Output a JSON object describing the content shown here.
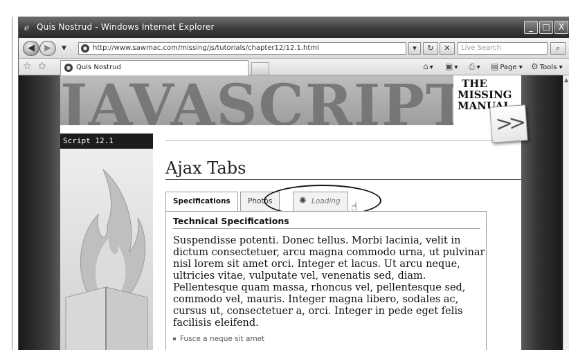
{
  "window": {
    "title": "Quis Nostrud - Windows Internet Explorer",
    "controls": {
      "minimize": "_",
      "maximize": "□",
      "close": "X"
    }
  },
  "address_bar": {
    "url": "http://www.sawmac.com/missing/js/tutorials/chapter12/12.1.html",
    "search_placeholder": "Live Search"
  },
  "tab_bar": {
    "active_tab": "Quis Nostrud",
    "commands": {
      "page": "Page",
      "tools": "Tools"
    }
  },
  "banner": {
    "word": "JAVASCRIPT",
    "lines": [
      "THE",
      "MISSING",
      "MANUAL"
    ],
    "arrow_label": ">>"
  },
  "sidebar": {
    "label": "Script 12.1"
  },
  "main": {
    "title": "Ajax Tabs",
    "tabs": [
      {
        "label": "Specifications",
        "active": true
      },
      {
        "label": "Photos",
        "active": false
      },
      {
        "label": "Loading",
        "active": false,
        "loading": true
      }
    ],
    "panel": {
      "heading": "Technical Specifications",
      "paragraph": "Suspendisse potenti. Donec tellus. Morbi lacinia, velit in dictum consectetuer, arcu magna commodo urna, ut pulvinar nisl lorem sit amet orci. Integer et lacus. Ut arcu neque, ultricies vitae, vulputate vel, venenatis sed, diam. Pellentesque quam massa, rhoncus vel, pellentesque sed, commodo vel, mauris. Integer magna libero, sodales ac, cursus ut, consectetuer a, orci. Integer in pede eget felis facilisis eleifend.",
      "list_item": "Fusce a neque sit amet"
    }
  },
  "icons": {
    "ie_logo": "ie-logo-icon",
    "back": "back-arrow-icon",
    "forward": "forward-arrow-icon",
    "refresh": "refresh-icon",
    "stop": "stop-icon",
    "search": "search-icon",
    "favorites": "favorites-star-icon",
    "add_favorite": "add-favorite-icon",
    "home": "home-icon",
    "feeds": "feeds-icon",
    "print": "print-icon",
    "spinner": "loading-spinner-icon",
    "cursor": "hand-cursor-icon"
  }
}
